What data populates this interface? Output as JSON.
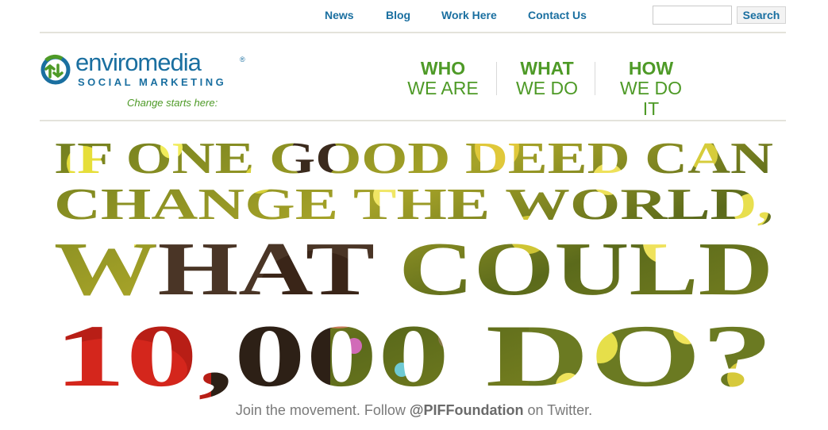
{
  "top_nav": {
    "items": [
      "News",
      "Blog",
      "Work Here",
      "Contact Us"
    ],
    "search_placeholder": "",
    "search_button": "Search"
  },
  "logo": {
    "wordmark": "enviromedia",
    "registered": "®",
    "subline": "SOCIAL MARKETING",
    "tagline": "Change starts here:"
  },
  "main_nav": [
    {
      "line1": "WHO",
      "line2": "WE ARE"
    },
    {
      "line1": "WHAT",
      "line2": "WE DO"
    },
    {
      "line1": "HOW",
      "line2": "WE DO IT"
    }
  ],
  "hero": {
    "lines": [
      "IF ONE GOOD DEED CAN",
      "CHANGE THE WORLD,",
      "WHAT COULD",
      "10,000 DO?"
    ]
  },
  "twitter": {
    "prefix": "Join the movement. Follow ",
    "handle": "@PIFFoundation",
    "suffix": " on Twitter."
  },
  "colors": {
    "blue": "#1a6fa0",
    "green": "#4e9a27",
    "rule": "#e4e3db"
  },
  "icons": [
    "enviromedia-logo-icon"
  ]
}
